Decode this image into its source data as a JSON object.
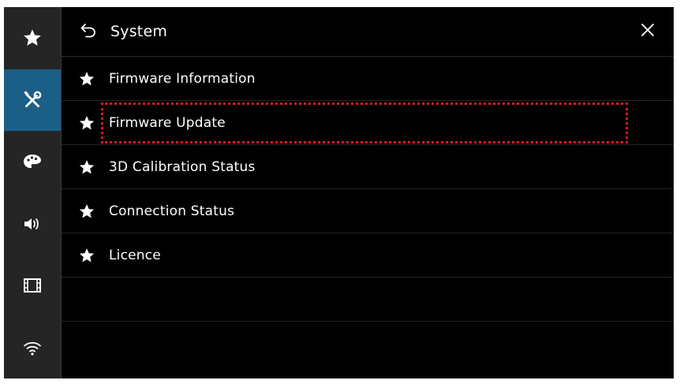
{
  "sidebar": {
    "items": [
      {
        "icon": "star-icon",
        "active": false
      },
      {
        "icon": "tools-icon",
        "active": true
      },
      {
        "icon": "palette-icon",
        "active": false
      },
      {
        "icon": "speaker-icon",
        "active": false
      },
      {
        "icon": "film-icon",
        "active": false
      },
      {
        "icon": "wifi-icon",
        "active": false
      }
    ]
  },
  "header": {
    "title": "System",
    "back_icon": "back-arrow-icon",
    "close_icon": "close-icon"
  },
  "menu": {
    "items": [
      {
        "label": "Firmware Information",
        "highlighted": false
      },
      {
        "label": "Firmware Update",
        "highlighted": true
      },
      {
        "label": "3D Calibration Status",
        "highlighted": false
      },
      {
        "label": "Connection Status",
        "highlighted": false
      },
      {
        "label": "Licence",
        "highlighted": false
      }
    ]
  },
  "colors": {
    "background": "#000000",
    "sidebar": "#252525",
    "active_accent": "#1c5f86",
    "highlight": "#e0191f",
    "text": "#ffffff"
  }
}
